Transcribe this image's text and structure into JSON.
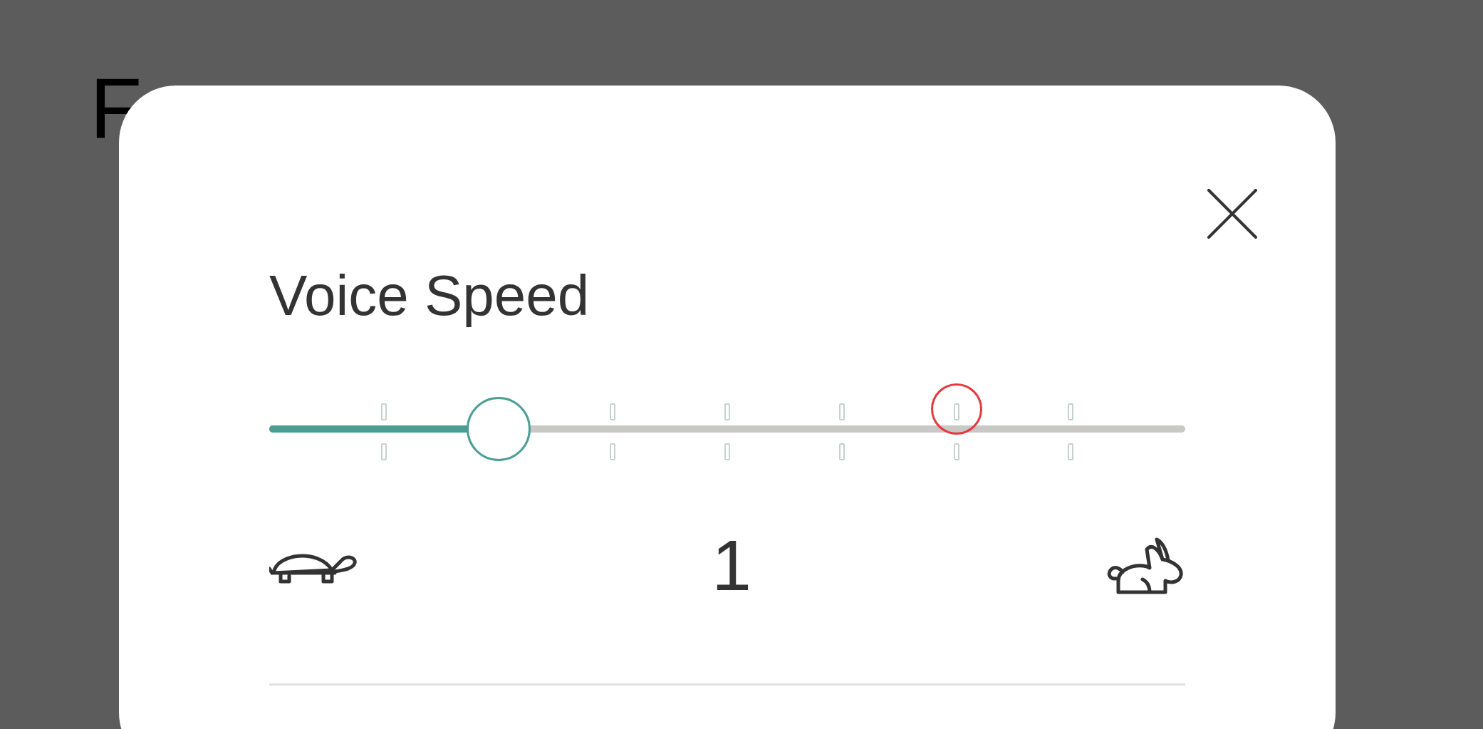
{
  "background_text": "F",
  "dialog": {
    "title": "Voice Speed",
    "speed_slider": {
      "level": 0.25
    },
    "speed_value": "1"
  }
}
